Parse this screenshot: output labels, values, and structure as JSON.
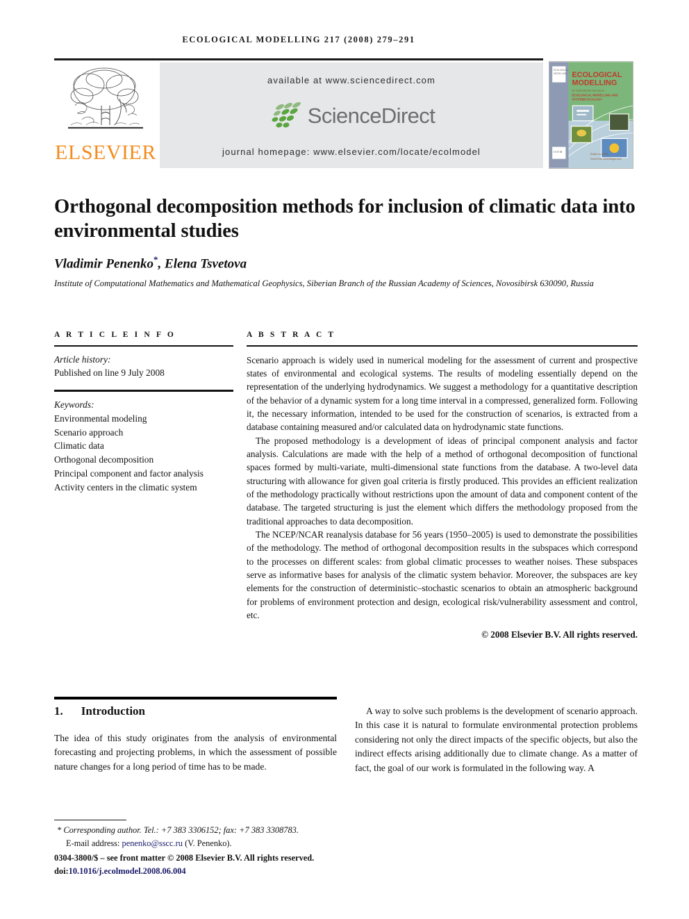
{
  "running_head": "ECOLOGICAL MODELLING 217 (2008) 279–291",
  "masthead": {
    "publisher_name": "ELSEVIER",
    "available_at": "available at www.sciencedirect.com",
    "logo_text": "ScienceDirect",
    "journal_homepage": "journal homepage: www.elsevier.com/locate/ecolmodel",
    "cover": {
      "journal_title_line1": "ECOLOGICAL",
      "journal_title_line2": "MODELLING",
      "subtitle": "An International Journal on",
      "scope_line1": "ECOLOGICAL MODELLING AND",
      "scope_line2": "SYSTEMS ECOLOGY",
      "editor_label": "Editor-in-Chief",
      "editor_name": "Sven Erik Jørgensen"
    }
  },
  "article": {
    "title": "Orthogonal decomposition methods for inclusion of climatic data into environmental studies",
    "authors": "Vladimir Penenko",
    "corresponding_marker": "*",
    "authors_rest": ", Elena Tsvetova",
    "affiliation": "Institute of Computational Mathematics and Mathematical Geophysics, Siberian Branch of the Russian Academy of Sciences, Novosibirsk 630090, Russia"
  },
  "article_info": {
    "heading": "A R T I C L E   I N F O",
    "history_label": "Article history:",
    "history_value": "Published on line 9 July 2008",
    "keywords_label": "Keywords:",
    "keywords": [
      "Environmental modeling",
      "Scenario approach",
      "Climatic data",
      "Orthogonal decomposition",
      "Principal component and factor analysis",
      "Activity centers in the climatic system"
    ]
  },
  "abstract": {
    "heading": "A B S T R A C T",
    "paragraphs": [
      "Scenario approach is widely used in numerical modeling for the assessment of current and prospective states of environmental and ecological systems. The results of modeling essentially depend on the representation of the underlying hydrodynamics. We suggest a methodology for a quantitative description of the behavior of a dynamic system for a long time interval in a compressed, generalized form. Following it, the necessary information, intended to be used for the construction of scenarios, is extracted from a database containing measured and/or calculated data on hydrodynamic state functions.",
      "The proposed methodology is a development of ideas of principal component analysis and factor analysis. Calculations are made with the help of a method of orthogonal decomposition of functional spaces formed by multi-variate, multi-dimensional state functions from the database. A two-level data structuring with allowance for given goal criteria is firstly produced. This provides an efficient realization of the methodology practically without restrictions upon the amount of data and component content of the database. The targeted structuring is just the element which differs the methodology proposed from the traditional approaches to data decomposition.",
      "The NCEP/NCAR reanalysis database for 56 years (1950–2005) is used to demonstrate the possibilities of the methodology. The method of orthogonal decomposition results in the subspaces which correspond to the processes on different scales: from global climatic processes to weather noises. These subspaces serve as informative bases for analysis of the climatic system behavior. Moreover, the subspaces are key elements for the construction of deterministic–stochastic scenarios to obtain an atmospheric background for problems of environment protection and design, ecological risk/vulnerability assessment and control, etc."
    ],
    "copyright": "© 2008 Elsevier B.V. All rights reserved."
  },
  "body": {
    "section_number": "1.",
    "section_title": "Introduction",
    "left_paragraph": "The idea of this study originates from the analysis of environmental forecasting and projecting problems, in which the assessment of possible nature changes for a long period of time has to be made.",
    "right_paragraph": "A way to solve such problems is the development of scenario approach. In this case it is natural to formulate environmental protection problems considering not only the direct impacts of the specific objects, but also the indirect effects arising additionally due to climate change. As a matter of fact, the goal of our work is formulated in the following way. A"
  },
  "footnotes": {
    "corresponding_marker": "*",
    "corresponding_text": "Corresponding author. Tel.: +7 383 3306152; fax: +7 383 3308783.",
    "email_label": "E-mail address:",
    "email": "penenko@sscc.ru",
    "email_suffix": "(V. Penenko).",
    "issn_line": "0304-3800/$ – see front matter © 2008 Elsevier B.V. All rights reserved.",
    "doi_label": "doi:",
    "doi_value": "10.1016/j.ecolmodel.2008.06.004"
  },
  "colors": {
    "elsevier_orange": "#F28C1E",
    "sciencedirect_green": "#5aa53f",
    "link_blue": "#1b1b6b",
    "band_gray": "#e6e7e8"
  }
}
